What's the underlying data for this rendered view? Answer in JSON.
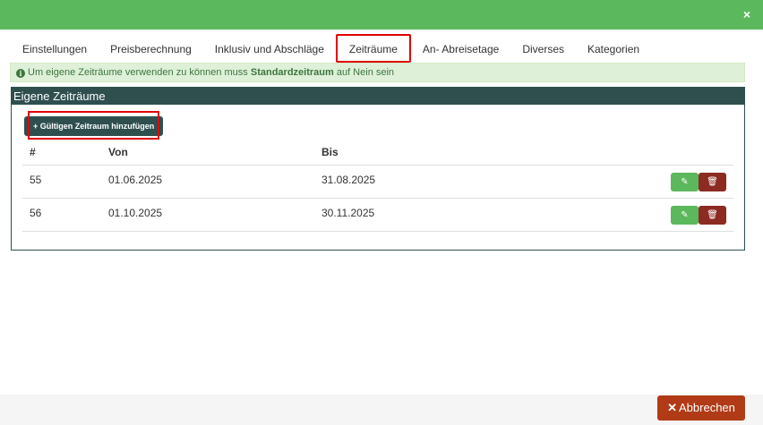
{
  "header": {
    "close_icon": "×"
  },
  "tabs": [
    {
      "label": "Einstellungen"
    },
    {
      "label": "Preisberechnung"
    },
    {
      "label": "Inklusiv und Abschläge"
    },
    {
      "label": "Zeiträume",
      "active": true
    },
    {
      "label": "An- Abreisetage"
    },
    {
      "label": "Diverses"
    },
    {
      "label": "Kategorien"
    }
  ],
  "alert": {
    "icon": "i",
    "text_before": "Um eigene Zeiträume verwenden zu können muss ",
    "bold": "Standardzeitraum",
    "text_after": " auf Nein sein"
  },
  "panel": {
    "title": "Eigene Zeiträume",
    "add_button": "+ Gültigen Zeitraum hinzufügen"
  },
  "table": {
    "headers": {
      "id": "#",
      "von": "Von",
      "bis": "Bis"
    },
    "rows": [
      {
        "id": "55",
        "von": "01.06.2025",
        "bis": "31.08.2025"
      },
      {
        "id": "56",
        "von": "01.10.2025",
        "bis": "30.11.2025"
      }
    ],
    "edit_icon": "✎",
    "delete_icon": "🗑"
  },
  "footer": {
    "cancel_icon": "✕",
    "cancel_label": "Abbrechen"
  },
  "colors": {
    "primary_green": "#5cb85c",
    "panel_dark": "#2f4f4f",
    "danger": "#8b2b22",
    "cancel": "#b13b17",
    "highlight": "#e00000"
  }
}
